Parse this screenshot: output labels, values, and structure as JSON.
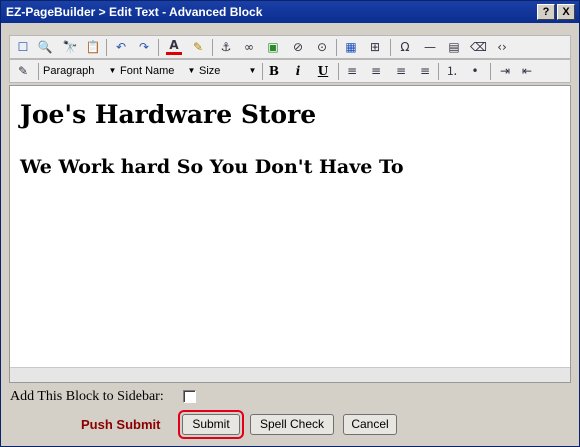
{
  "window": {
    "title": "EZ-PageBuilder > Edit Text - Advanced Block",
    "help_label": "?",
    "close_label": "X"
  },
  "toolbar1": {
    "icons": [
      "source-icon",
      "preview-icon",
      "find-icon",
      "paste-icon",
      "undo-icon",
      "redo-icon",
      "text-color-icon",
      "bg-color-icon",
      "anchor-icon",
      "link-icon",
      "image-icon",
      "flash-icon",
      "media-icon",
      "table-icon",
      "form-icon",
      "special-char-icon",
      "horizontal-rule-icon",
      "page-break-icon",
      "remove-format-icon",
      "code-icon"
    ],
    "glyphs": [
      "☐",
      "🔍",
      "🔭",
      "📋",
      "↶",
      "↷",
      "A",
      "✎",
      "⚓",
      "∞",
      "▣",
      "⊘",
      "⊙",
      "▦",
      "⊞",
      "Ω",
      "—",
      "▤",
      "⌫",
      "‹›"
    ]
  },
  "toolbar2": {
    "style_edit_glyph": "✎",
    "format_value": "Paragraph",
    "font_value": "Font Name",
    "size_value": "Size",
    "bold": "B",
    "italic": "i",
    "underline": "U",
    "align_glyphs": [
      "≡",
      "≡",
      "≡",
      "≡"
    ],
    "list_glyphs": [
      "⒈",
      "•"
    ],
    "indent_glyphs": [
      "⇥",
      "⇤"
    ]
  },
  "editor": {
    "heading1": "Joe's Hardware Store",
    "heading2": "We Work hard So You Don't Have To"
  },
  "form": {
    "sidebar_label": "Add This Block to Sidebar:",
    "push_hint": "Push Submit",
    "submit_label": "Submit",
    "spell_label": "Spell Check",
    "cancel_label": "Cancel"
  },
  "colors": {
    "title_bar": "#0a2d8f",
    "hint": "#8b0000",
    "highlight": "#e0001a"
  }
}
